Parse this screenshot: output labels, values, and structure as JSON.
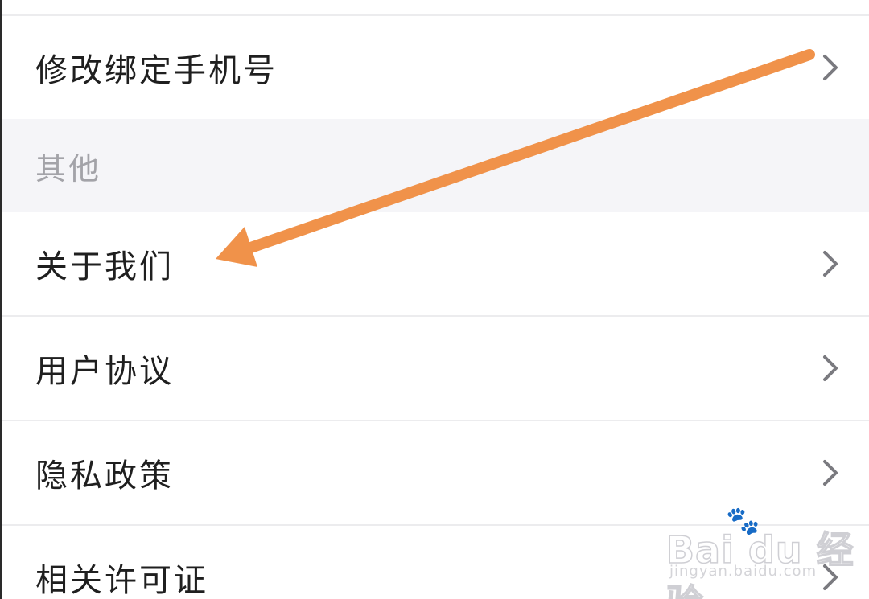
{
  "menu": {
    "change_phone": "修改绑定手机号",
    "section_other": "其他",
    "about_us": "关于我们",
    "user_agreement": "用户协议",
    "privacy_policy": "隐私政策",
    "licenses": "相关许可证"
  },
  "annotation": {
    "arrow_color": "#F0924A"
  },
  "watermark": {
    "brand": "Bai  du 经验",
    "paw_icon": "paw-icon",
    "url": "jingyan.baidu.com"
  },
  "colors": {
    "section_bg": "#F5F5F8",
    "divider": "#ECECEE",
    "chevron": "#7A7A7F"
  }
}
